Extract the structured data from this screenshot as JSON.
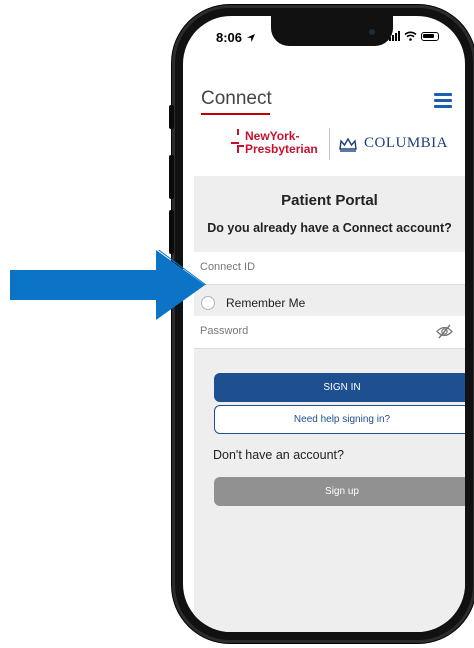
{
  "status_bar": {
    "time": "8:06"
  },
  "header": {
    "app_name": "Connect"
  },
  "logos": {
    "nyp_line1": "NewYork-",
    "nyp_line2": "Presbyterian",
    "columbia": "COLUMBIA"
  },
  "portal": {
    "title": "Patient Portal",
    "question": "Do you already have a Connect account?",
    "connect_id_placeholder": "Connect ID",
    "remember_me_label": "Remember Me",
    "password_placeholder": "Password",
    "sign_in_label": "SIGN IN",
    "help_label": "Need help signing in?",
    "no_account_text": "Don't have an account?",
    "sign_up_label": "Sign up"
  },
  "colors": {
    "primary": "#1d4f91",
    "arrow": "#0b74c7",
    "brand_red": "#c8102e",
    "menu_blue": "#1a5fb4",
    "signup_gray": "#919191"
  },
  "icons": [
    "location-arrow-icon",
    "signal-icon",
    "wifi-icon",
    "battery-icon",
    "menu-icon",
    "eye-slash-icon",
    "crown-icon"
  ]
}
